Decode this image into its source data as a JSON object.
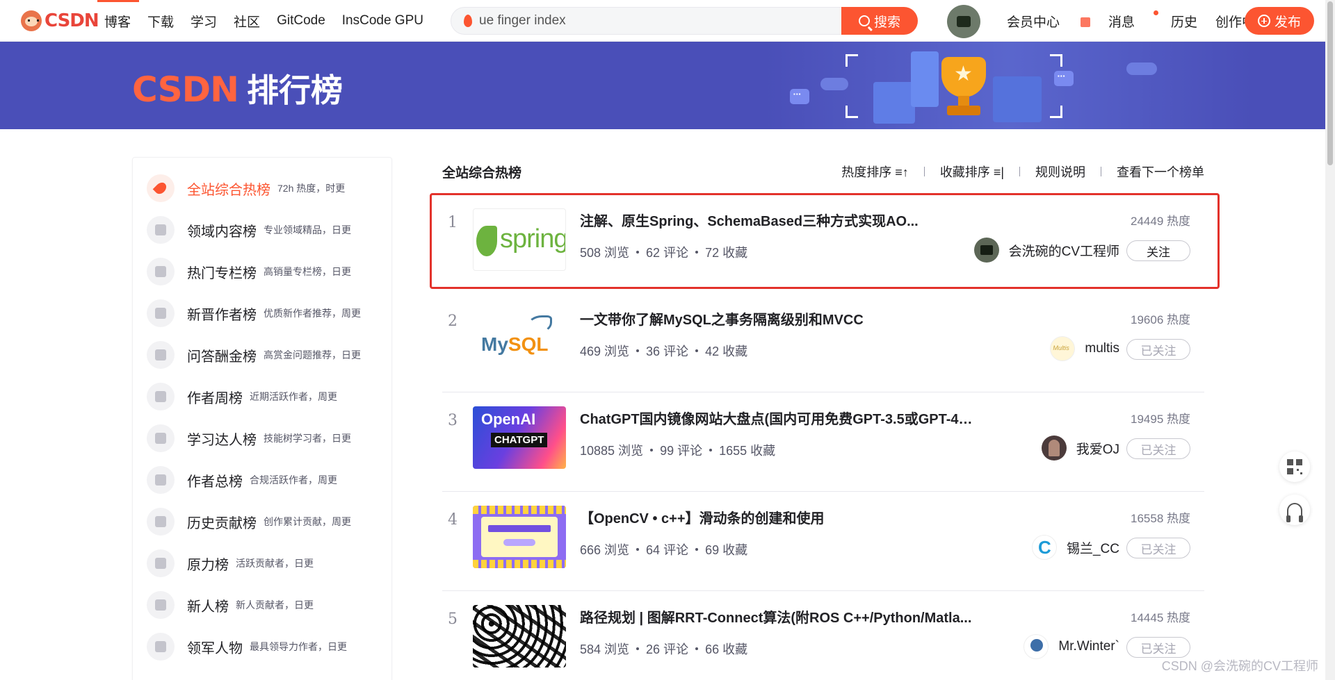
{
  "topnav": {
    "logo_text": "CSDN",
    "links": [
      "博客",
      "下载",
      "学习",
      "社区",
      "GitCode",
      "InsCode GPU"
    ],
    "search_value": "ue finger index",
    "search_button": "搜索",
    "right_links": [
      "会员中心",
      "消息",
      "历史",
      "创作中心"
    ],
    "publish_button": "发布",
    "accent_color": "#fc5531"
  },
  "banner": {
    "brand": "CSDN",
    "title": "排行榜",
    "background": "#4a4fb8"
  },
  "sidebar": {
    "items": [
      {
        "label": "全站综合热榜",
        "desc": "72h 热度，时更",
        "active": true,
        "icon": "rocket-icon"
      },
      {
        "label": "领域内容榜",
        "desc": "专业领域精品，日更",
        "active": false,
        "icon": "code-icon"
      },
      {
        "label": "热门专栏榜",
        "desc": "高销量专栏榜，日更",
        "active": false,
        "icon": "bookmark-icon"
      },
      {
        "label": "新晋作者榜",
        "desc": "优质新作者推荐，周更",
        "active": false,
        "icon": "user-icon"
      },
      {
        "label": "问答酬金榜",
        "desc": "高赏金问题推荐，日更",
        "active": false,
        "icon": "question-icon"
      },
      {
        "label": "作者周榜",
        "desc": "近期活跃作者，周更",
        "active": false,
        "icon": "calendar-icon"
      },
      {
        "label": "学习达人榜",
        "desc": "技能树学习者，日更",
        "active": false,
        "icon": "medal-icon"
      },
      {
        "label": "作者总榜",
        "desc": "合规活跃作者，周更",
        "active": false,
        "icon": "trophy-icon"
      },
      {
        "label": "历史贡献榜",
        "desc": "创作累计贡献，周更",
        "active": false,
        "icon": "chart-icon"
      },
      {
        "label": "原力榜",
        "desc": "活跃贡献者，日更",
        "active": false,
        "icon": "power-icon"
      },
      {
        "label": "新人榜",
        "desc": "新人贡献者，日更",
        "active": false,
        "icon": "sprout-icon"
      },
      {
        "label": "领军人物",
        "desc": "最具领导力作者，日更",
        "active": false,
        "icon": "leader-icon"
      }
    ]
  },
  "list": {
    "title": "全站综合热榜",
    "tools": [
      "热度排序 ≡↑",
      "收藏排序 ≡|",
      "规则说明",
      "查看下一个榜单"
    ],
    "items": [
      {
        "rank": "1",
        "title": "注解、原生Spring、SchemaBased三种方式实现AO...",
        "views": "508 浏览",
        "comments": "62 评论",
        "favorites": "72 收藏",
        "heat": "24449 热度",
        "author": "会洗碗的CV工程师",
        "follow": "关注",
        "followed": false,
        "thumb": "spring"
      },
      {
        "rank": "2",
        "title": "一文带你了解MySQL之事务隔离级别和MVCC",
        "views": "469 浏览",
        "comments": "36 评论",
        "favorites": "42 收藏",
        "heat": "19606 热度",
        "author": "multis",
        "follow": "已关注",
        "followed": true,
        "thumb": "mysql"
      },
      {
        "rank": "3",
        "title": "ChatGPT国内镜像网站大盘点(国内可用免费GPT-3.5或GPT-4镜...",
        "views": "10885 浏览",
        "comments": "99 评论",
        "favorites": "1655 收藏",
        "heat": "19495 热度",
        "author": "我爱OJ",
        "follow": "已关注",
        "followed": true,
        "thumb": "openai"
      },
      {
        "rank": "4",
        "title": "【OpenCV • c++】滑动条的创建和使用",
        "views": "666 浏览",
        "comments": "64 评论",
        "favorites": "69 收藏",
        "heat": "16558 热度",
        "author": "锡兰_CC",
        "follow": "已关注",
        "followed": true,
        "thumb": "opencv"
      },
      {
        "rank": "5",
        "title": "路径规划 | 图解RRT-Connect算法(附ROS C++/Python/Matla...",
        "views": "584 浏览",
        "comments": "26 评论",
        "favorites": "66 收藏",
        "heat": "14445 热度",
        "author": "Mr.Winter`",
        "follow": "已关注",
        "followed": true,
        "thumb": "rrt"
      }
    ],
    "thumb_text": {
      "spring": "spring",
      "mysql_a": "My",
      "mysql_b": "SQL",
      "openai_1": "OpenAI",
      "openai_2": "CHATGPT"
    }
  },
  "watermark": "CSDN @会洗碗的CV工程师"
}
